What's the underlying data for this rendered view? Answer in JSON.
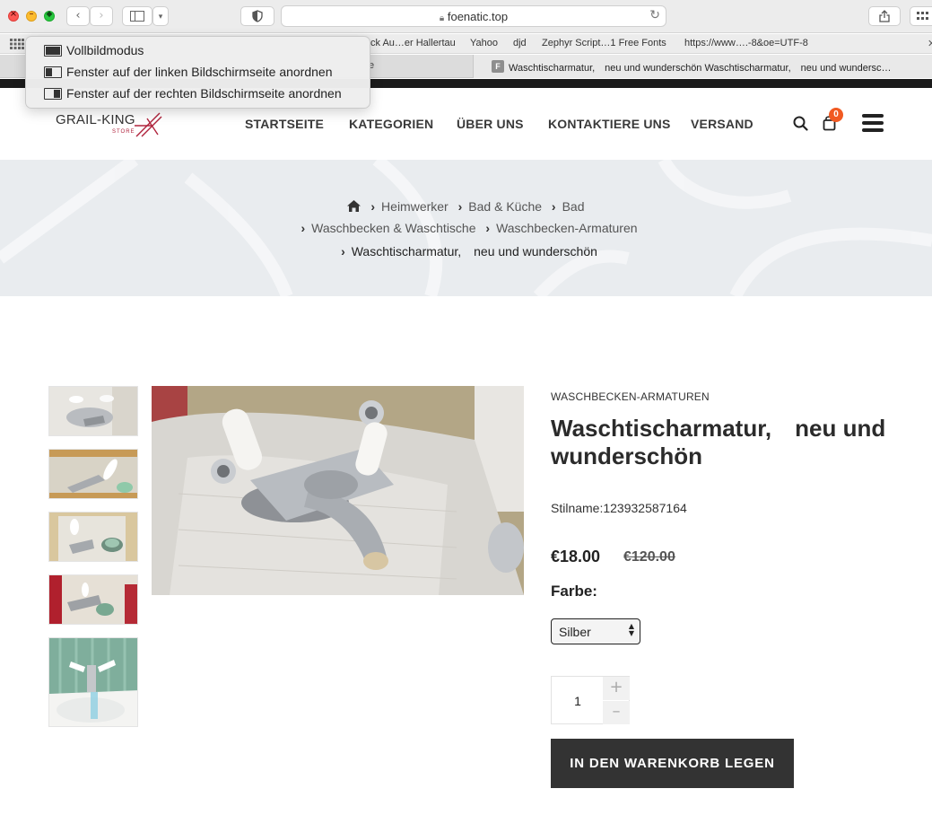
{
  "browser": {
    "url": "foenatic.top",
    "bookmarks": [
      "ck Au…er Hallertau",
      "Yahoo",
      "djd",
      "Zephyr Script…1 Free Fonts",
      "https://www….-8&oe=UTF-8"
    ],
    "tab_favicon": "F",
    "tab_title": "Waschtischarmatur,　neu und wunderschön Waschtischarmatur,　neu und wundersc…",
    "window_menu": [
      {
        "label": "Vollbildmodus",
        "icon": "fullscreen-icon"
      },
      {
        "label": "Fenster auf der linken Bildschirmseite anordnen",
        "icon": "tile-left-icon"
      },
      {
        "label": "Fenster auf der rechten Bildschirmseite anordnen",
        "icon": "tile-right-icon"
      }
    ]
  },
  "site": {
    "logo_text": "GRAIL-KING",
    "logo_sub": "STORE",
    "nav": [
      "STARTSEITE",
      "KATEGORIEN",
      "ÜBER UNS",
      "KONTAKTIERE UNS",
      "VERSAND"
    ],
    "cart_count": "0",
    "accent_color": "#f15a22"
  },
  "breadcrumb": {
    "items": [
      "Heimwerker",
      "Bad & Küche",
      "Bad",
      "Waschbecken & Waschtische",
      "Waschbecken-Armaturen"
    ],
    "current": "Waschtischarmatur,　neu und wunderschön"
  },
  "product": {
    "category": "WASCHBECKEN-ARMATUREN",
    "title": "Waschtischarmatur,　neu und wunderschön",
    "style_name": "Stilname:123932587164",
    "price": "€18.00",
    "old_price": "€120.00",
    "color_label": "Farbe:",
    "color_selected": "Silber",
    "quantity": "1",
    "add_to_cart": "IN DEN WARENKORB LEGEN"
  }
}
